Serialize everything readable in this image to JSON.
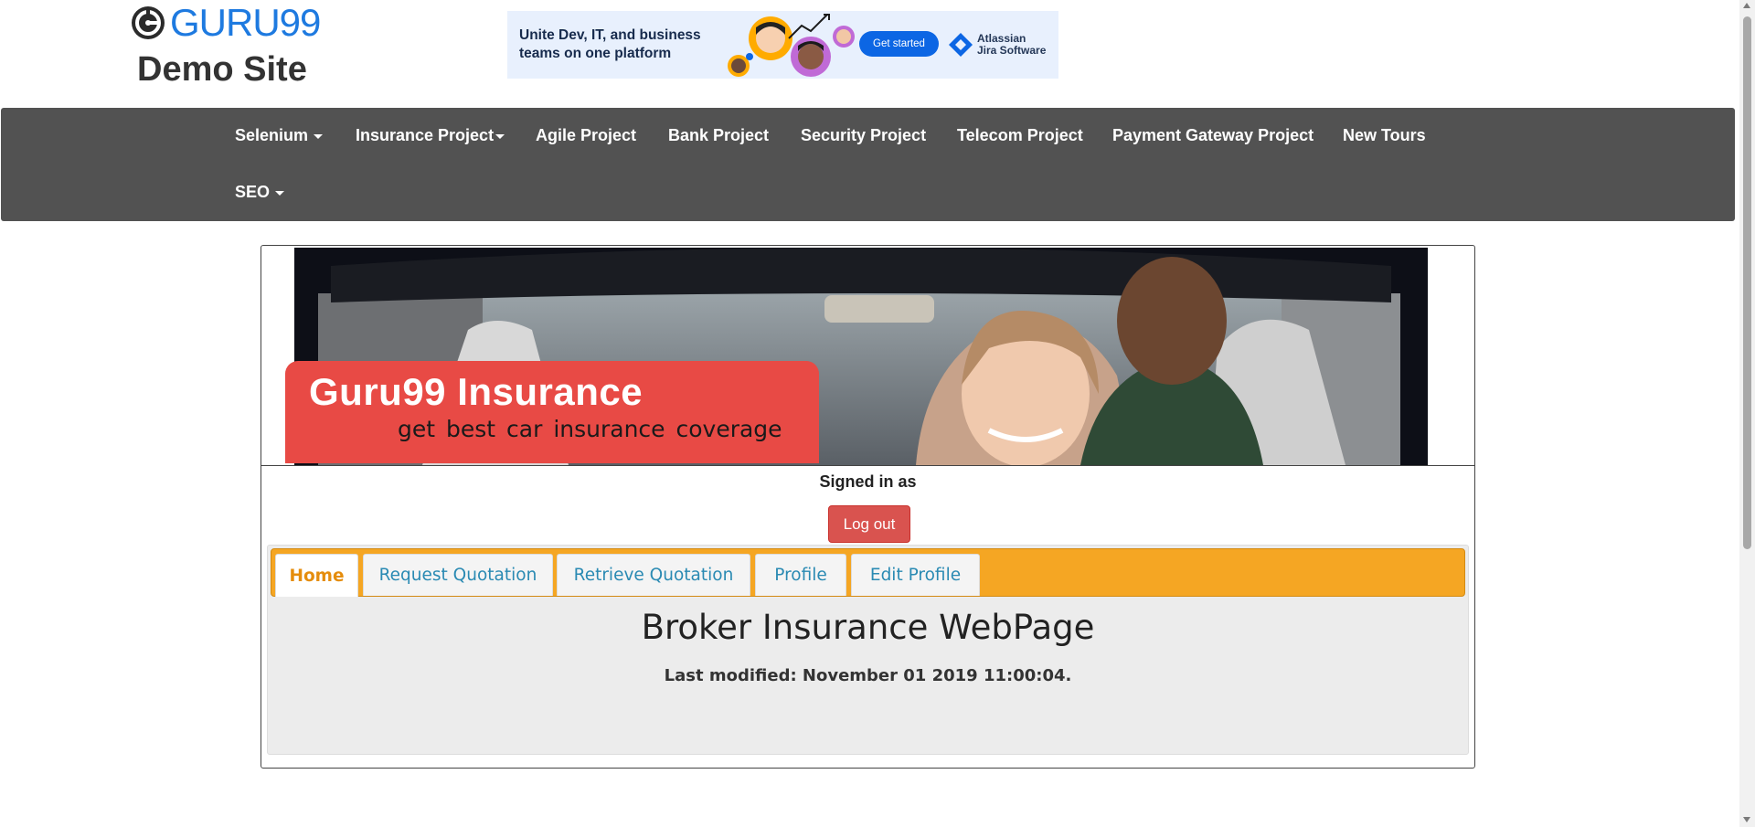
{
  "header": {
    "logo_text": "GURU99",
    "logo_subtitle": "Demo Site"
  },
  "ad": {
    "text": "Unite Dev, IT, and business teams on one platform",
    "button": "Get started",
    "brand_line1": "Atlassian",
    "brand_line2": "Jira Software"
  },
  "nav": {
    "items": [
      {
        "label": "Selenium",
        "dropdown": true
      },
      {
        "label": "Insurance Project",
        "dropdown": true
      },
      {
        "label": "Agile Project",
        "dropdown": false
      },
      {
        "label": "Bank Project",
        "dropdown": false
      },
      {
        "label": "Security Project",
        "dropdown": false
      },
      {
        "label": "Telecom Project",
        "dropdown": false
      },
      {
        "label": "Payment Gateway Project",
        "dropdown": false
      },
      {
        "label": "New Tours",
        "dropdown": false
      },
      {
        "label": "SEO",
        "dropdown": true
      }
    ]
  },
  "banner": {
    "title": "Guru99 Insurance",
    "subtitle": "get best car insurance coverage"
  },
  "session": {
    "signed_in_label": "Signed in as",
    "logout_label": "Log out"
  },
  "tabs": [
    {
      "label": "Home",
      "active": true
    },
    {
      "label": "Request Quotation",
      "active": false
    },
    {
      "label": "Retrieve Quotation",
      "active": false
    },
    {
      "label": "Profile",
      "active": false
    },
    {
      "label": "Edit Profile",
      "active": false
    }
  ],
  "main": {
    "heading": "Broker Insurance WebPage",
    "last_modified": "Last modified: November 01 2019 11:00:04."
  },
  "colors": {
    "navbar": "#525252",
    "brand_blue": "#1e7ae0",
    "tab_bar": "#f5a623",
    "active_tab_text": "#e58d0d",
    "tab_text": "#2a8ab3",
    "logout": "#d9534f",
    "banner_red": "#e84a45"
  }
}
